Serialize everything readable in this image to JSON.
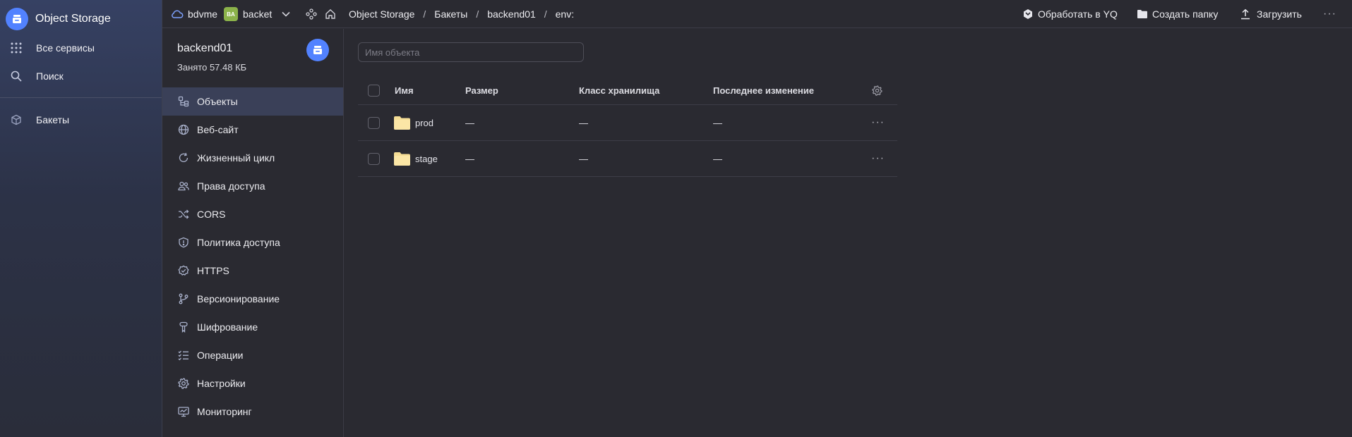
{
  "nav": {
    "brand": "Object Storage",
    "items": [
      {
        "label": "Все сервисы",
        "icon": "grid-icon"
      },
      {
        "label": "Поиск",
        "icon": "search-icon"
      },
      {
        "label": "Бакеты",
        "icon": "cube-icon"
      }
    ]
  },
  "topbar": {
    "cloud": "bdvme",
    "folder_badge": "BA",
    "folder": "backet",
    "breadcrumbs": [
      "Object Storage",
      "Бакеты",
      "backend01",
      "env:"
    ],
    "breadcrumb_separator": "/",
    "actions": {
      "process_yq": "Обработать в YQ",
      "create_folder": "Создать папку",
      "upload": "Загрузить",
      "more": "···"
    }
  },
  "bucket": {
    "name": "backend01",
    "used": "Занято 57.48 КБ",
    "menu": [
      {
        "label": "Объекты",
        "icon": "objects-icon",
        "active": true
      },
      {
        "label": "Веб-сайт",
        "icon": "globe-icon"
      },
      {
        "label": "Жизненный цикл",
        "icon": "lifecycle-icon"
      },
      {
        "label": "Права доступа",
        "icon": "users-icon"
      },
      {
        "label": "CORS",
        "icon": "shuffle-icon"
      },
      {
        "label": "Политика доступа",
        "icon": "shield-icon"
      },
      {
        "label": "HTTPS",
        "icon": "check-shield-icon"
      },
      {
        "label": "Версионирование",
        "icon": "branch-icon"
      },
      {
        "label": "Шифрование",
        "icon": "key-icon"
      },
      {
        "label": "Операции",
        "icon": "list-check-icon"
      },
      {
        "label": "Настройки",
        "icon": "gear-icon"
      },
      {
        "label": "Мониторинг",
        "icon": "monitor-icon"
      }
    ]
  },
  "objects": {
    "search_placeholder": "Имя объекта",
    "columns": {
      "name": "Имя",
      "size": "Размер",
      "storage_class": "Класс хранилища",
      "modified": "Последнее изменение"
    },
    "rows": [
      {
        "name": "prod",
        "size": "—",
        "storage_class": "—",
        "modified": "—"
      },
      {
        "name": "stage",
        "size": "—",
        "storage_class": "—",
        "modified": "—"
      }
    ],
    "row_menu": "···"
  },
  "colors": {
    "accent": "#5282ff",
    "folder_badge": "#8bb24a",
    "folder_icon": "#f5dd95",
    "background": "#2a2a31"
  }
}
